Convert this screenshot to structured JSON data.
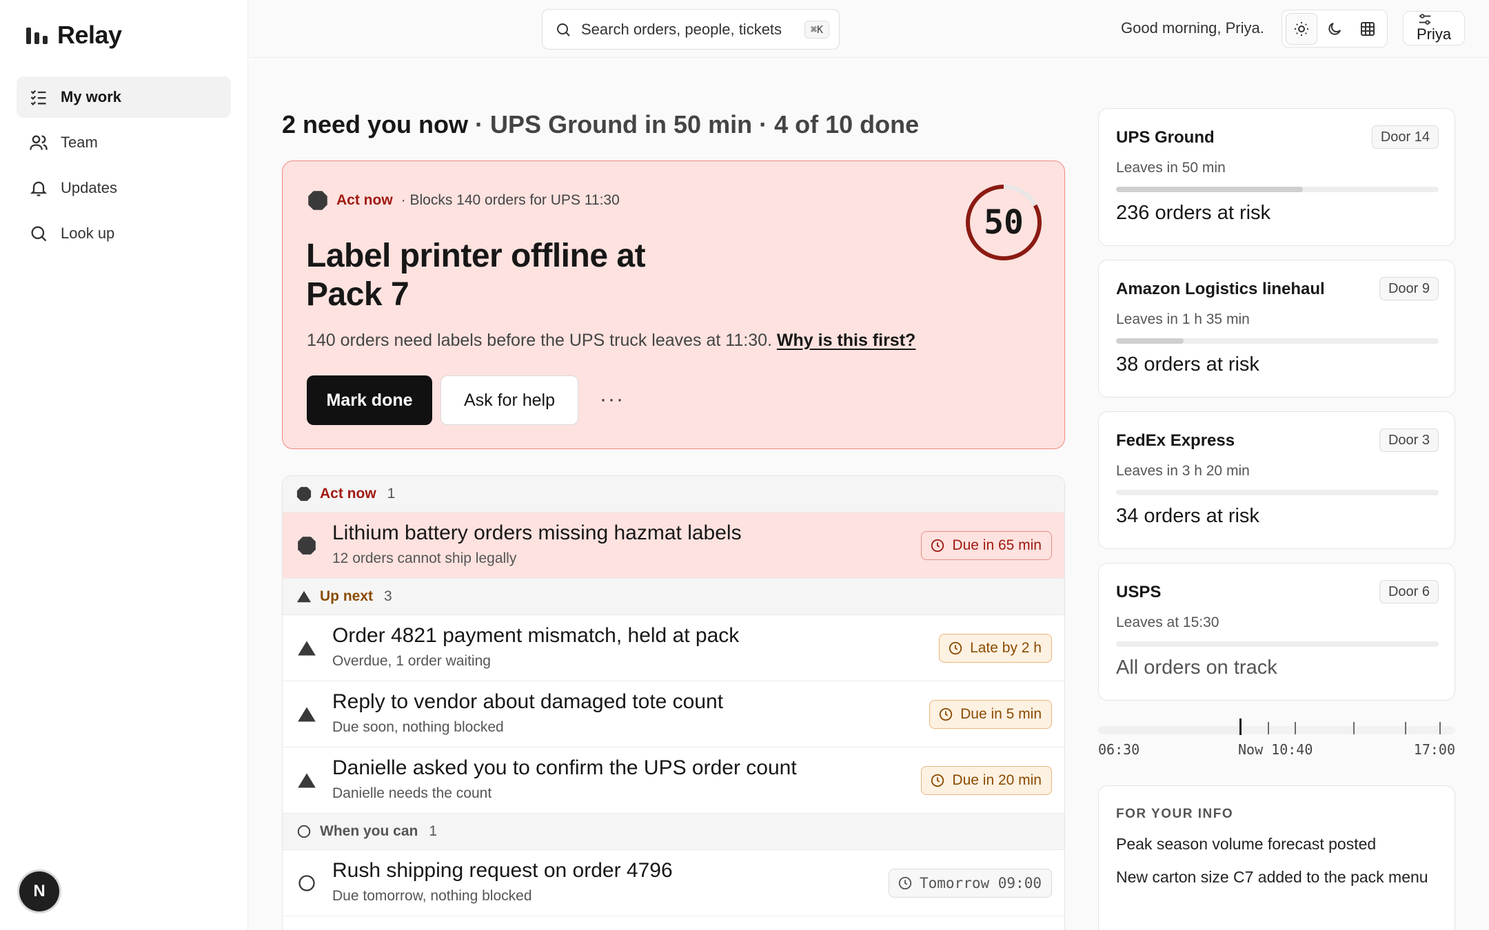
{
  "app": {
    "name": "Relay"
  },
  "sidebar": {
    "items": [
      {
        "label": "My work",
        "icon": "list-check-icon",
        "active": true
      },
      {
        "label": "Team",
        "icon": "users-icon",
        "active": false
      },
      {
        "label": "Updates",
        "icon": "bell-icon",
        "active": false
      },
      {
        "label": "Look up",
        "icon": "search-icon",
        "active": false
      }
    ],
    "avatar_initial": "N"
  },
  "topbar": {
    "search_placeholder": "Search orders, people, tickets",
    "search_shortcut": "⌘K",
    "greeting": "Good morning, Priya.",
    "theme_options": [
      "sun-icon",
      "moon-icon",
      "grid-icon"
    ],
    "user_name": "Priya"
  },
  "headline": {
    "need": "2 need you now",
    "sep1": " · ",
    "truck": "UPS Ground in 50 min",
    "sep2": " ·  ",
    "progress": "4 of 10 done"
  },
  "hero": {
    "tag": "Act now",
    "blocks": "· Blocks 140 orders for UPS 11:30",
    "title": "Label printer offline at Pack 7",
    "description": "140 orders need labels before the UPS truck leaves at 11:30.",
    "why_link": "Why is this first?",
    "primary_button": "Mark done",
    "secondary_button": "Ask for help",
    "more_button": "···",
    "countdown": "50",
    "countdown_progress": 0.83
  },
  "tasks": {
    "groups": [
      {
        "label": "Act now",
        "count": "1",
        "kind": "act",
        "items": [
          {
            "title": "Lithium battery orders missing hazmat labels",
            "sub": "12 orders cannot ship legally",
            "due": "Due in 65 min",
            "tone": "red"
          }
        ]
      },
      {
        "label": "Up next",
        "count": "3",
        "kind": "next",
        "items": [
          {
            "title": "Order 4821 payment mismatch, held at pack",
            "sub": "Overdue, 1 order waiting",
            "due": "Late by 2 h",
            "tone": "amber"
          },
          {
            "title": "Reply to vendor about damaged tote count",
            "sub": "Due soon, nothing blocked",
            "due": "Due in 5 min",
            "tone": "amber"
          },
          {
            "title": "Danielle asked you to confirm the UPS order count",
            "sub": "Danielle needs the count",
            "due": "Due in 20 min",
            "tone": "amber"
          }
        ]
      },
      {
        "label": "When you can",
        "count": "1",
        "kind": "can",
        "items": [
          {
            "title": "Rush shipping request on order 4796",
            "sub": "Due tomorrow, nothing blocked",
            "due": "Tomorrow 09:00",
            "tone": "grey"
          }
        ]
      }
    ]
  },
  "carriers": [
    {
      "name": "UPS Ground",
      "door": "Door 14",
      "leaves": "Leaves in 50 min",
      "progress": 0.58,
      "risk": "236 orders at risk",
      "ok": false
    },
    {
      "name": "Amazon Logistics linehaul",
      "door": "Door 9",
      "leaves": "Leaves in 1 h 35 min",
      "progress": 0.21,
      "risk": "38 orders at risk",
      "ok": false
    },
    {
      "name": "FedEx Express",
      "door": "Door 3",
      "leaves": "Leaves in 3 h 20 min",
      "progress": 0.0,
      "risk": "34 orders at risk",
      "ok": false
    },
    {
      "name": "USPS",
      "door": "Door 6",
      "leaves": "Leaves at 15:30",
      "progress": 0.0,
      "risk": "All orders on track",
      "ok": true
    }
  ],
  "timeline": {
    "start": "06:30",
    "now": "Now 10:40",
    "end": "17:00"
  },
  "fyi": {
    "title": "FOR YOUR INFO",
    "items": [
      "Peak season volume forecast posted",
      "New carton size C7 added to the pack menu"
    ]
  }
}
